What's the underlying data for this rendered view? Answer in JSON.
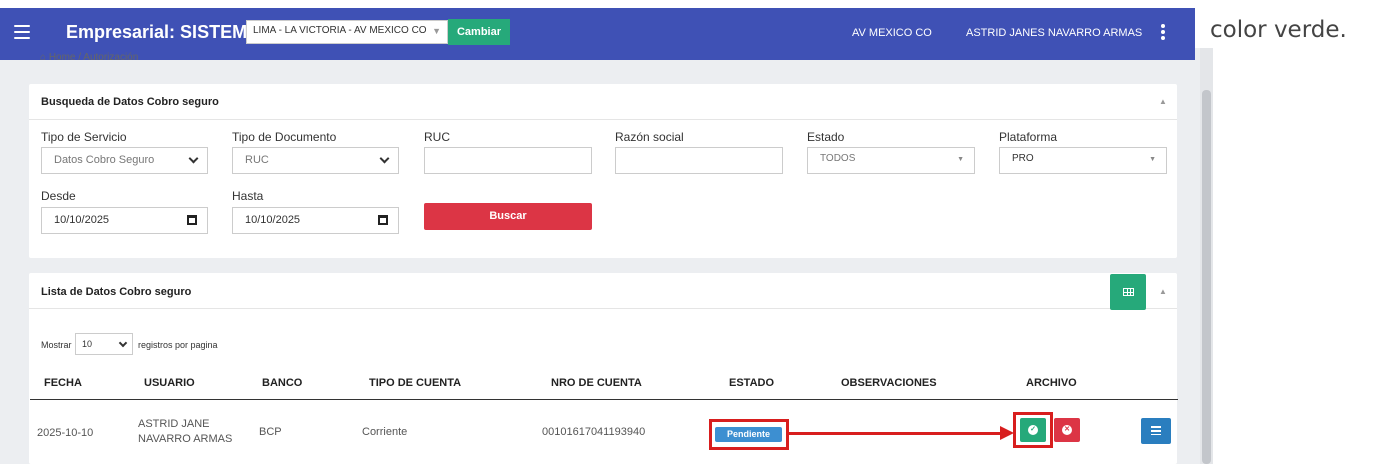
{
  "topbar": {
    "brand": "Empresarial: SISTEMAS",
    "branch_select": "LIMA - LA VICTORIA - AV MEXICO CO",
    "change_button": "Cambiar",
    "location": "AV MEXICO CO",
    "user": "ASTRID JANES NAVARRO ARMAS",
    "color": "#3f51b5"
  },
  "outside_text": "color verde.",
  "breadcrumb": "⌂ Home / Autorización",
  "search": {
    "title": "Busqueda de Datos Cobro seguro",
    "fields": {
      "tipo_servicio": {
        "label": "Tipo de Servicio",
        "value": "Datos Cobro Seguro"
      },
      "tipo_documento": {
        "label": "Tipo de Documento",
        "value": "RUC"
      },
      "ruc": {
        "label": "RUC",
        "value": ""
      },
      "razon_social": {
        "label": "Razón social",
        "value": ""
      },
      "estado": {
        "label": "Estado",
        "value": "TODOS"
      },
      "plataforma": {
        "label": "Plataforma",
        "value": "PRO"
      },
      "desde": {
        "label": "Desde",
        "value": "10/10/2025"
      },
      "hasta": {
        "label": "Hasta",
        "value": "10/10/2025"
      }
    },
    "search_button": "Buscar"
  },
  "list": {
    "title": "Lista de Datos Cobro seguro",
    "mostrar_label": "Mostrar",
    "page_size": "10",
    "registros_label": "registros por pagina",
    "columns": [
      "FECHA",
      "USUARIO",
      "BANCO",
      "TIPO DE CUENTA",
      "NRO DE CUENTA",
      "ESTADO",
      "OBSERVACIONES",
      "ARCHIVO"
    ],
    "rows": [
      {
        "fecha": "2025-10-10",
        "usuario_line1": "ASTRID JANE",
        "usuario_line2": "NAVARRO ARMAS",
        "banco": "BCP",
        "tipo_cuenta": "Corriente",
        "nro_cuenta": "00101617041193940",
        "estado": "Pendiente",
        "observaciones": ""
      }
    ]
  },
  "icons": {
    "menu": "hamburger-icon",
    "kebab": "kebab-menu-icon",
    "export": "table-grid-icon",
    "approve": "check-circle-icon",
    "reject": "times-circle-icon",
    "detail": "list-icon"
  },
  "colors": {
    "success": "#26a97a",
    "danger": "#dc3545",
    "info": "#3d8fd1",
    "annotation": "#d81e1e"
  }
}
